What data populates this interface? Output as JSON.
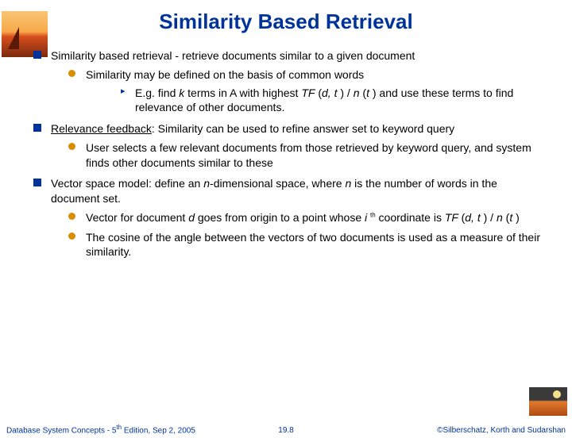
{
  "title": "Similarity Based Retrieval",
  "b1": {
    "text": "Similarity based retrieval - retrieve documents similar to a given document",
    "s1": {
      "text": "Similarity may be defined on the basis of common words",
      "ss1_pre": "E.g. find ",
      "ss1_k": "k",
      "ss1_mid1": " terms in A with highest ",
      "ss1_tf": "TF",
      "ss1_paren1": " (",
      "ss1_d": "d, t ",
      "ss1_mid2": ") / ",
      "ss1_n": "n ",
      "ss1_paren2": "(",
      "ss1_t": "t ",
      "ss1_post": ") and use these terms to find relevance of other documents."
    }
  },
  "b2": {
    "term": "Relevance feedback",
    "text": ": Similarity can be used to refine answer set to keyword query",
    "s1": "User selects a few relevant documents from those retrieved by keyword query, and system finds other documents similar to these"
  },
  "b3": {
    "pre": "Vector space model: define an ",
    "n1": "n",
    "mid": "-dimensional space, where ",
    "n2": "n",
    "post": " is the number of words in the document set.",
    "s1_pre": "Vector for document ",
    "s1_d": "d",
    "s1_mid1": " goes from origin to a point whose ",
    "s1_i": "i ",
    "s1_th": "th",
    "s1_mid2": " coordinate is ",
    "s1_tf": "TF ",
    "s1_paren1": "(",
    "s1_dt": "d, t ",
    "s1_mid3": ") / ",
    "s1_n": "n ",
    "s1_paren2": "(",
    "s1_t": "t ",
    "s1_post": ")",
    "s2": "The cosine of the angle between the vectors of two documents is used as a measure of their similarity."
  },
  "footer": {
    "left_pre": "Database System Concepts - 5",
    "left_th": "th",
    "left_post": " Edition, Sep 2, 2005",
    "center": "19.8",
    "right": "©Silberschatz, Korth and Sudarshan"
  }
}
